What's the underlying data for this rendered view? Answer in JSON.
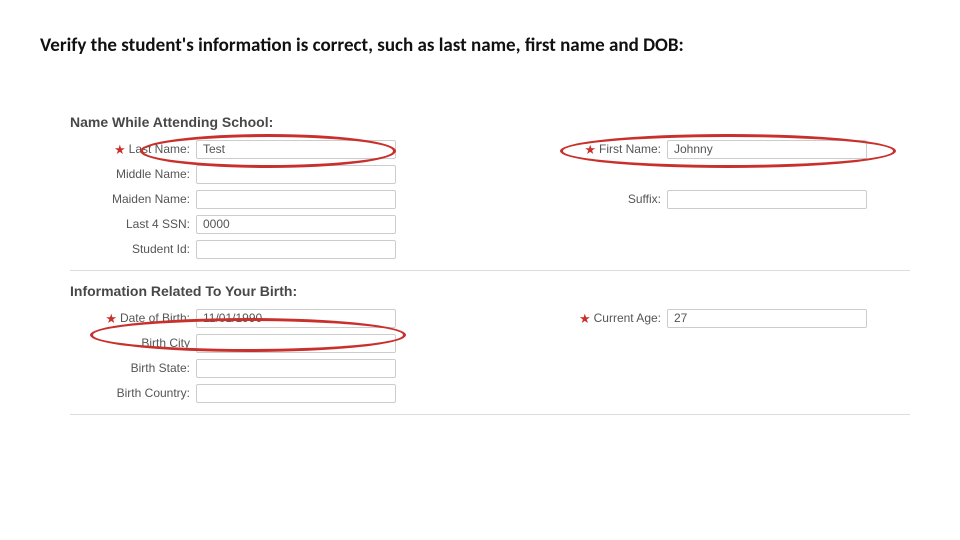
{
  "instruction": "Verify the student's information is correct, such as last name, first name and DOB:",
  "section1": {
    "heading": "Name While Attending School:",
    "last_name": {
      "label": "Last Name:",
      "value": "Test",
      "required": true
    },
    "first_name": {
      "label": "First Name:",
      "value": "Johnny",
      "required": true
    },
    "middle_name": {
      "label": "Middle Name:",
      "value": ""
    },
    "maiden_name": {
      "label": "Maiden Name:",
      "value": ""
    },
    "suffix": {
      "label": "Suffix:",
      "value": ""
    },
    "last4ssn": {
      "label": "Last 4 SSN:",
      "value": "0000"
    },
    "student_id": {
      "label": "Student Id:",
      "value": ""
    }
  },
  "section2": {
    "heading": "Information Related To Your Birth:",
    "dob": {
      "label": "Date of Birth:",
      "value": "11/01/1990",
      "required": true
    },
    "current_age": {
      "label": "Current Age:",
      "value": "27",
      "required": true
    },
    "birth_city": {
      "label": "Birth City",
      "value": ""
    },
    "birth_state": {
      "label": "Birth State:",
      "value": ""
    },
    "birth_country": {
      "label": "Birth Country:",
      "value": ""
    }
  },
  "star": "★"
}
